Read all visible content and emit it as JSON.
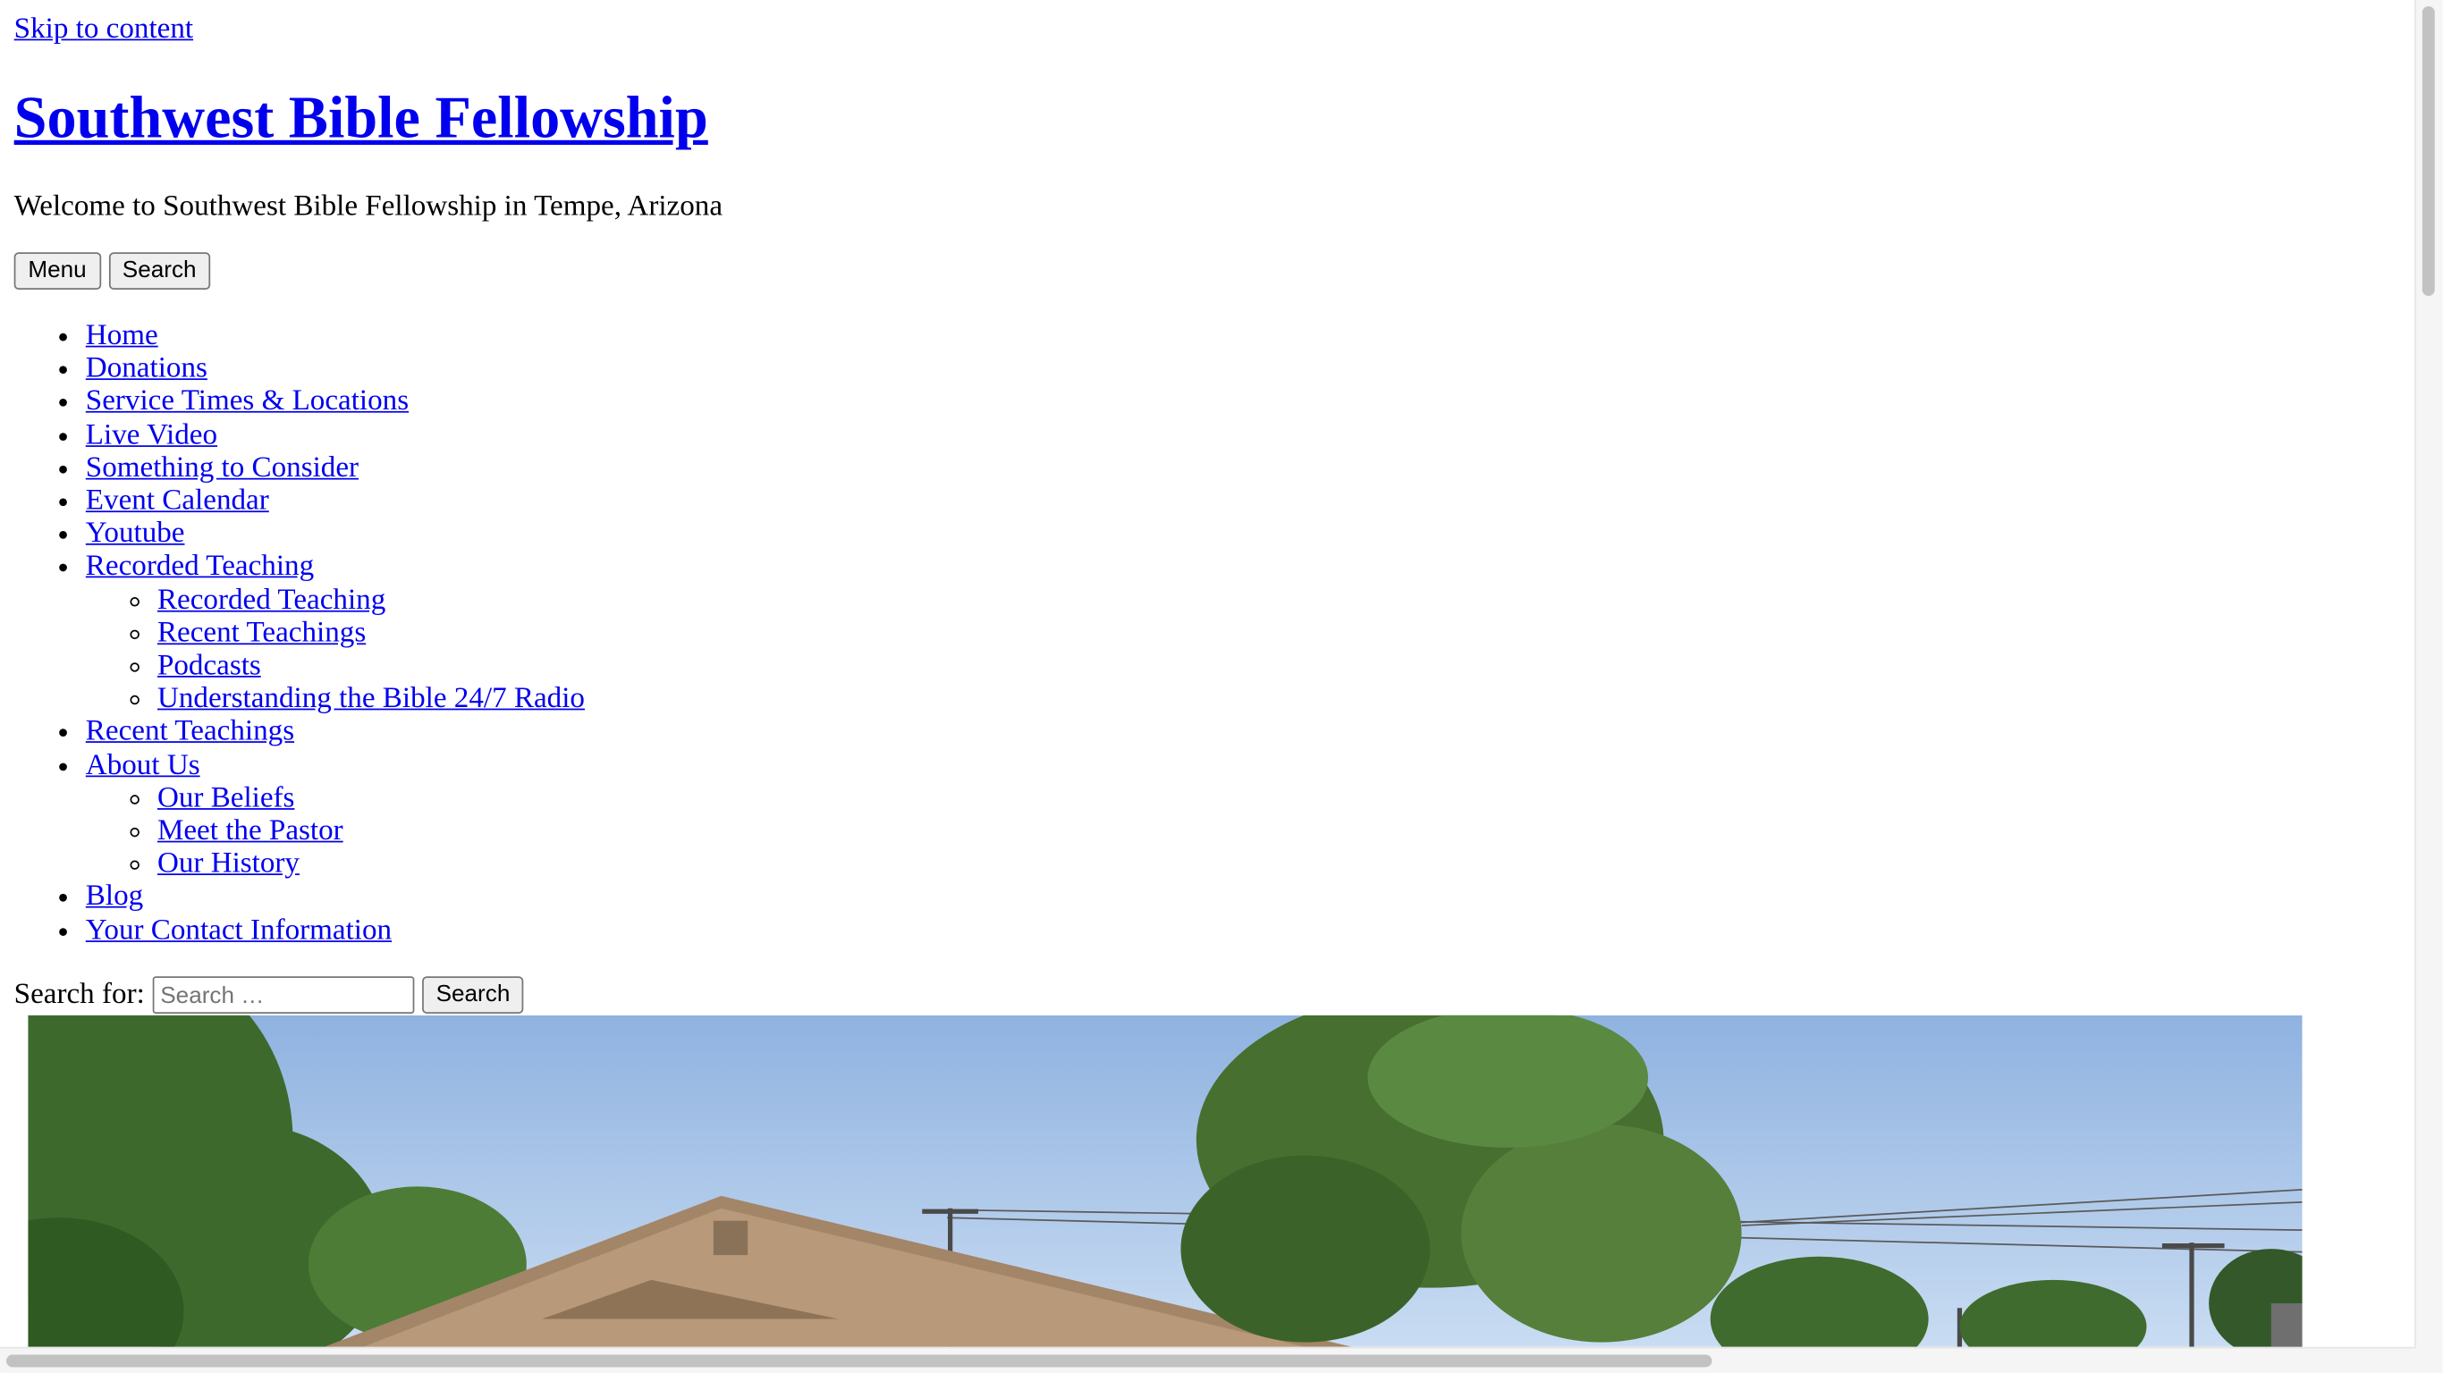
{
  "skip_link": "Skip to content",
  "site": {
    "title": "Southwest Bible Fellowship",
    "tagline": "Welcome to Southwest Bible Fellowship in Tempe, Arizona"
  },
  "buttons": {
    "menu": "Menu",
    "search": "Search"
  },
  "nav": {
    "home": "Home",
    "donations": "Donations",
    "service_times": "Service Times & Locations",
    "live_video": "Live Video",
    "something_to_consider": "Something to Consider",
    "event_calendar": "Event Calendar",
    "youtube": "Youtube",
    "recorded_teaching": "Recorded Teaching",
    "recorded_sub": {
      "recorded_teaching": "Recorded Teaching",
      "recent_teachings": "Recent Teachings",
      "podcasts": "Podcasts",
      "radio": "Understanding the Bible 24/7 Radio"
    },
    "recent_teachings": "Recent Teachings",
    "about_us": "About Us",
    "about_sub": {
      "our_beliefs": "Our Beliefs",
      "meet_pastor": "Meet the Pastor",
      "our_history": "Our History"
    },
    "blog": "Blog",
    "contact": "Your Contact Information"
  },
  "search_form": {
    "label": "Search for:",
    "placeholder": "Search …",
    "submit": "Search"
  },
  "colors": {
    "link": "#0000ee",
    "sky": "#9ebde6",
    "foliage": "#3f6b2e",
    "building": "#a88a6c"
  }
}
